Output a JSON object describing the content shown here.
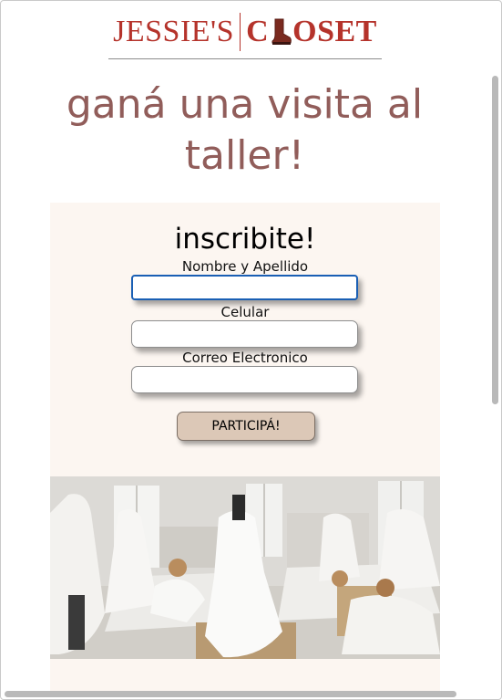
{
  "brand": {
    "logo_left": "JESSIE'S",
    "logo_right_a": "C",
    "logo_right_b": "OSET",
    "color": "#b5332b"
  },
  "headline": "ganá una visita al taller!",
  "form": {
    "title": "inscribite!",
    "fields": [
      {
        "label": "Nombre y Apellido",
        "value": "",
        "placeholder": ""
      },
      {
        "label": "Celular",
        "value": "",
        "placeholder": ""
      },
      {
        "label": "Correo Electronico",
        "value": "",
        "placeholder": ""
      }
    ],
    "submit_label": "PARTICIPÁ!"
  },
  "colors": {
    "headline": "#915d5a",
    "panel_bg": "#fcf6f1",
    "button_bg": "#dcc8b7"
  }
}
